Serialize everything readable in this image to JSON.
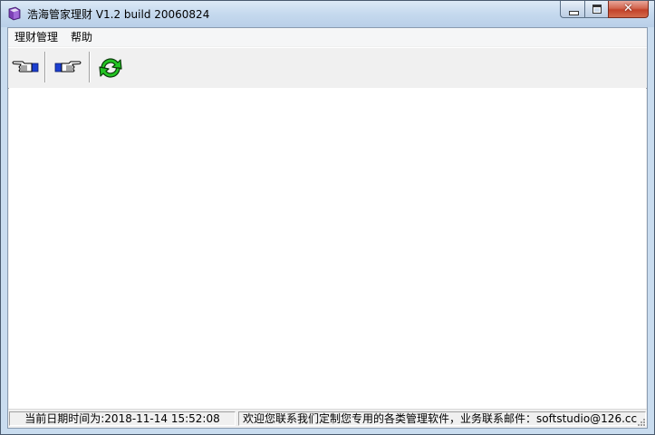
{
  "window": {
    "title": "浩海管家理财 V1.2 build 20060824",
    "app_icon": "app-book-icon",
    "close_glyph": "✕"
  },
  "menu": {
    "items": [
      {
        "label": "理财管理"
      },
      {
        "label": "帮助"
      }
    ]
  },
  "toolbar": {
    "buttons": [
      {
        "icon": "hand-point-left-icon"
      },
      {
        "icon": "hand-point-right-icon"
      },
      {
        "icon": "refresh-arrows-icon"
      }
    ]
  },
  "statusbar": {
    "datetime_text": "当前日期时间为:2018-11-14 15:52:08",
    "contact_text": "欢迎您联系我们定制您专用的各类管理软件，业务联系邮件：softstudio@126.cc"
  },
  "colors": {
    "titlebar": "#c5d9ee",
    "close_button": "#c34229",
    "refresh_icon": "#22c422"
  }
}
